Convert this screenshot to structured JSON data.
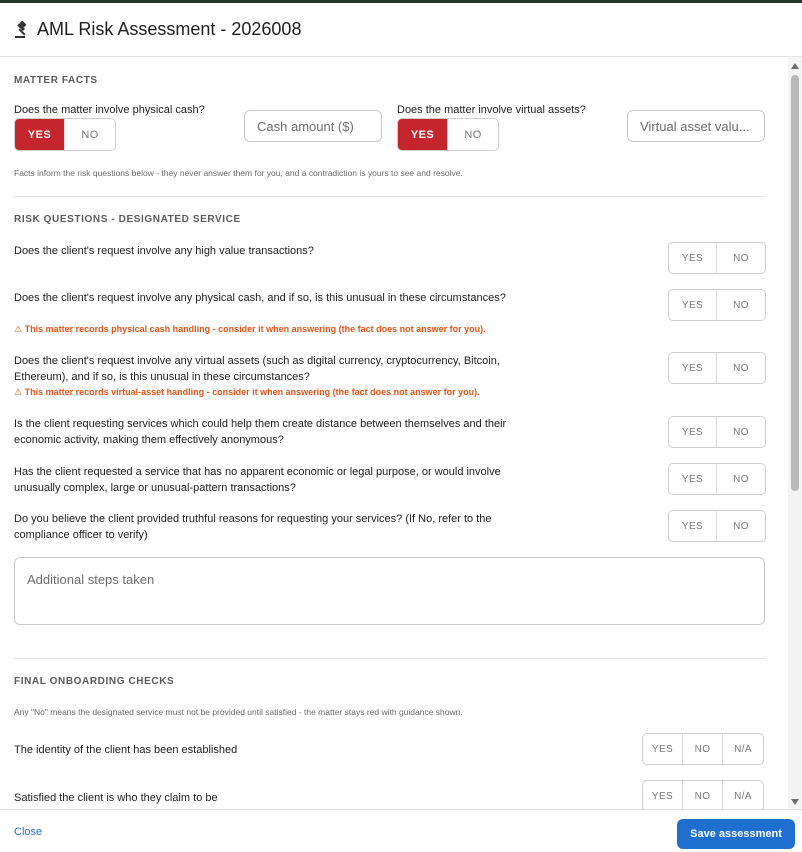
{
  "header": {
    "title": "AML Risk Assessment - 2026008",
    "icon": "gavel-icon"
  },
  "matter_facts": {
    "section_title": "MATTER FACTS",
    "cash_question": "Does the matter involve physical cash?",
    "cash_yes": "YES",
    "cash_no": "NO",
    "cash_selected": "YES",
    "cash_amount_placeholder": "Cash amount ($)",
    "virtual_question": "Does the matter involve virtual assets?",
    "virtual_yes": "YES",
    "virtual_no": "NO",
    "virtual_selected": "YES",
    "virtual_value_placeholder": "Virtual asset valu...",
    "note": "Facts inform the risk questions below - they never answer them for you, and a contradiction is yours to see and resolve."
  },
  "risk_questions": {
    "section_title": "RISK QUESTIONS - DESIGNATED SERVICE",
    "questions": [
      {
        "text": "Does the client's request involve any high value transactions?",
        "yes": "YES",
        "no": "NO"
      },
      {
        "text": "Does the client's request involve any physical cash, and if so, is this unusual in these circumstances?",
        "yes": "YES",
        "no": "NO",
        "warning": "⚠ This matter records physical cash handling - consider it when answering (the fact does not answer for you)."
      },
      {
        "text": "Does the client's request involve any virtual assets (such as digital currency, cryptocurrency, Bitcoin, Ethereum), and if so, is this unusual in these circumstances?",
        "yes": "YES",
        "no": "NO",
        "warning": "⚠ This matter records virtual-asset handling - consider it when answering (the fact does not answer for you)."
      },
      {
        "text": "Is the client requesting services which could help them create distance between themselves and their economic activity, making them effectively anonymous?",
        "yes": "YES",
        "no": "NO"
      },
      {
        "text": "Has the client requested a service that has no apparent economic or legal purpose, or would involve unusually complex, large or unusual-pattern transactions?",
        "yes": "YES",
        "no": "NO"
      },
      {
        "text": "Do you believe the client provided truthful reasons for requesting your services? (If No, refer to the compliance officer to verify)",
        "yes": "YES",
        "no": "NO"
      }
    ],
    "additional_steps_placeholder": "Additional steps taken"
  },
  "final_checks": {
    "section_title": "FINAL ONBOARDING CHECKS",
    "note": "Any \"No\" means the designated service must not be provided until satisfied - the matter stays red with guidance shown.",
    "checks": [
      {
        "text": "The identity of the client has been established",
        "yes": "YES",
        "no": "NO",
        "na": "N/A"
      },
      {
        "text": "Satisfied the client is who they claim to be",
        "yes": "YES",
        "no": "NO",
        "na": "N/A"
      }
    ]
  },
  "footer": {
    "close_label": "Close",
    "save_label": "Save assessment"
  },
  "colors": {
    "selected": "#c5252c",
    "primary": "#1f6fd1",
    "warning": "#e0561a"
  }
}
